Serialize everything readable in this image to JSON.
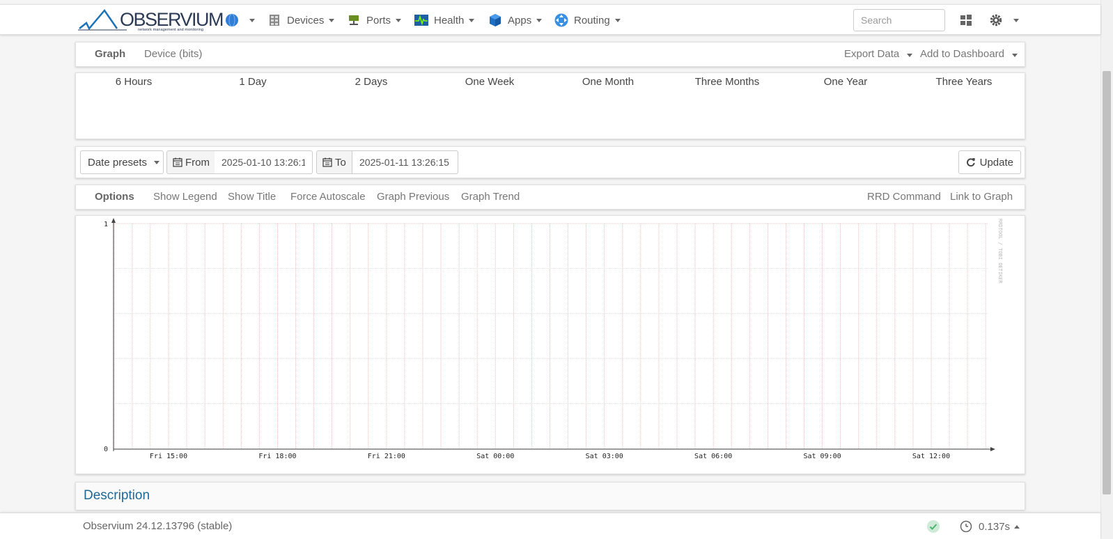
{
  "brand": {
    "name": "OBSERVIUM",
    "tagline": "network management and monitoring"
  },
  "nav": {
    "items": [
      {
        "label": "",
        "icon": "globe-icon"
      },
      {
        "label": "Devices",
        "icon": "server-icon"
      },
      {
        "label": "Ports",
        "icon": "network-port-icon"
      },
      {
        "label": "Health",
        "icon": "heartbeat-icon"
      },
      {
        "label": "Apps",
        "icon": "cube-icon"
      },
      {
        "label": "Routing",
        "icon": "routing-icon"
      }
    ],
    "search_placeholder": "Search",
    "right_icons": [
      "windows-icon",
      "gear-icon"
    ]
  },
  "graph_tabs": {
    "title": "Graph",
    "current": "Device (bits)",
    "export": "Export Data",
    "dashboard": "Add to Dashboard"
  },
  "timeframes": [
    "6 Hours",
    "1 Day",
    "2 Days",
    "One Week",
    "One Month",
    "Three Months",
    "One Year",
    "Three Years"
  ],
  "date_range": {
    "presets": "Date presets",
    "from_label": "From",
    "from_value": "2025-01-10 13:26:1",
    "to_label": "To",
    "to_value": "2025-01-11 13:26:15",
    "update": "Update"
  },
  "options": {
    "title": "Options",
    "left": [
      "Show Legend",
      "Show Title",
      "Force Autoscale",
      "Graph Previous",
      "Graph Trend"
    ],
    "right": [
      "RRD Command",
      "Link to Graph"
    ]
  },
  "chart_data": {
    "type": "line",
    "x_ticks": [
      "Fri 15:00",
      "Fri 18:00",
      "Fri 21:00",
      "Sat 00:00",
      "Sat 03:00",
      "Sat 06:00",
      "Sat 09:00",
      "Sat 12:00"
    ],
    "y_ticks": [
      "0",
      "1"
    ],
    "ylim": [
      0,
      1
    ],
    "series": [],
    "watermark": "RRDTOOL / TOBI OETIKER",
    "colors": {
      "vgrid": "#f4b0b0",
      "hgrid": "#d8d8d8"
    }
  },
  "description": {
    "title": "Description"
  },
  "footer": {
    "version": "Observium 24.12.13796 (stable)",
    "time": "0.137s"
  },
  "colors": {
    "link": "#1c6896",
    "accent": "#2f7ed8"
  }
}
